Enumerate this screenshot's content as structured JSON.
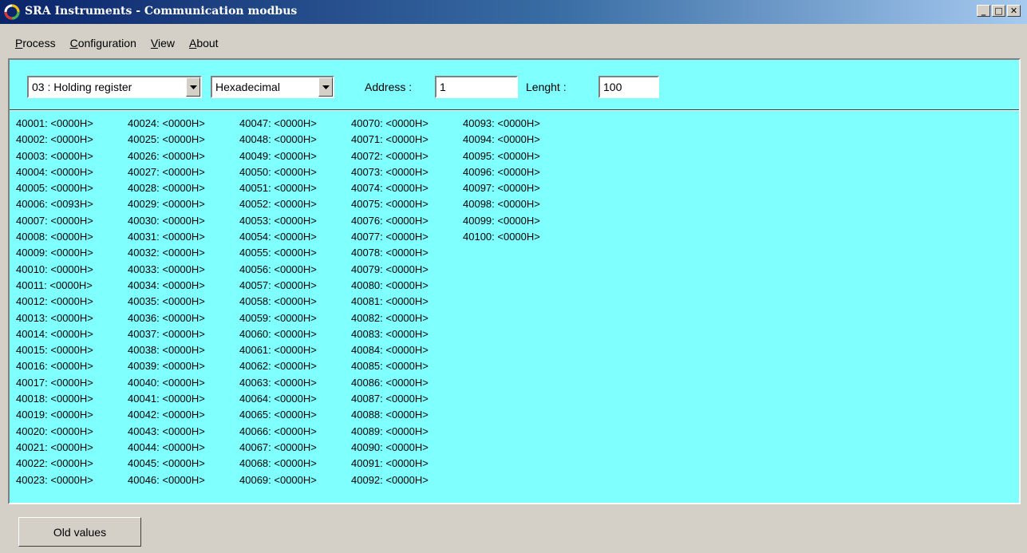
{
  "window": {
    "title": "SRA Instruments - Communication modbus",
    "controls": {
      "minimize": "_",
      "maximize": "□",
      "close": "✕"
    }
  },
  "menu": [
    "Process",
    "Configuration",
    "View",
    "About"
  ],
  "toolbar": {
    "register_type": "03 : Holding register",
    "format": "Hexadecimal",
    "address_label": "Address :",
    "address_value": "1",
    "length_label": "Lenght :",
    "length_value": "100"
  },
  "registers": [
    "40001: <0000H>",
    "40002: <0000H>",
    "40003: <0000H>",
    "40004: <0000H>",
    "40005: <0000H>",
    "40006: <0093H>",
    "40007: <0000H>",
    "40008: <0000H>",
    "40009: <0000H>",
    "40010: <0000H>",
    "40011: <0000H>",
    "40012: <0000H>",
    "40013: <0000H>",
    "40014: <0000H>",
    "40015: <0000H>",
    "40016: <0000H>",
    "40017: <0000H>",
    "40018: <0000H>",
    "40019: <0000H>",
    "40020: <0000H>",
    "40021: <0000H>",
    "40022: <0000H>",
    "40023: <0000H>",
    "40024: <0000H>",
    "40025: <0000H>",
    "40026: <0000H>",
    "40027: <0000H>",
    "40028: <0000H>",
    "40029: <0000H>",
    "40030: <0000H>",
    "40031: <0000H>",
    "40032: <0000H>",
    "40033: <0000H>",
    "40034: <0000H>",
    "40035: <0000H>",
    "40036: <0000H>",
    "40037: <0000H>",
    "40038: <0000H>",
    "40039: <0000H>",
    "40040: <0000H>",
    "40041: <0000H>",
    "40042: <0000H>",
    "40043: <0000H>",
    "40044: <0000H>",
    "40045: <0000H>",
    "40046: <0000H>",
    "40047: <0000H>",
    "40048: <0000H>",
    "40049: <0000H>",
    "40050: <0000H>",
    "40051: <0000H>",
    "40052: <0000H>",
    "40053: <0000H>",
    "40054: <0000H>",
    "40055: <0000H>",
    "40056: <0000H>",
    "40057: <0000H>",
    "40058: <0000H>",
    "40059: <0000H>",
    "40060: <0000H>",
    "40061: <0000H>",
    "40062: <0000H>",
    "40063: <0000H>",
    "40064: <0000H>",
    "40065: <0000H>",
    "40066: <0000H>",
    "40067: <0000H>",
    "40068: <0000H>",
    "40069: <0000H>",
    "40070: <0000H>",
    "40071: <0000H>",
    "40072: <0000H>",
    "40073: <0000H>",
    "40074: <0000H>",
    "40075: <0000H>",
    "40076: <0000H>",
    "40077: <0000H>",
    "40078: <0000H>",
    "40079: <0000H>",
    "40080: <0000H>",
    "40081: <0000H>",
    "40082: <0000H>",
    "40083: <0000H>",
    "40084: <0000H>",
    "40085: <0000H>",
    "40086: <0000H>",
    "40087: <0000H>",
    "40088: <0000H>",
    "40089: <0000H>",
    "40090: <0000H>",
    "40091: <0000H>",
    "40092: <0000H>",
    "40093: <0000H>",
    "40094: <0000H>",
    "40095: <0000H>",
    "40096: <0000H>",
    "40097: <0000H>",
    "40098: <0000H>",
    "40099: <0000H>",
    "40100: <0000H>"
  ],
  "buttons": {
    "old_values": "Old values"
  },
  "colors": {
    "panel_bg": "#80ffff",
    "window_bg": "#d4d0c8",
    "title_start": "#0a246a",
    "title_end": "#a6caf0"
  }
}
